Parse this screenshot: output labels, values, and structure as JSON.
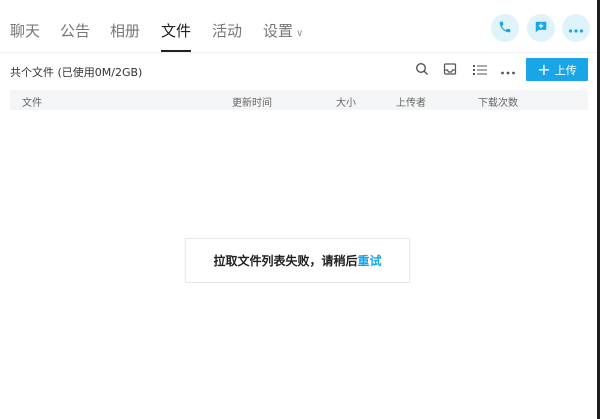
{
  "tabs": [
    {
      "label": "聊天"
    },
    {
      "label": "公告"
    },
    {
      "label": "相册"
    },
    {
      "label": "文件",
      "active": true
    },
    {
      "label": "活动"
    },
    {
      "label": "设置"
    }
  ],
  "header_icons": [
    "phone-icon",
    "chat-message-icon",
    "more-icon"
  ],
  "toolbar": {
    "title": "共个文件 (已使用0M/2GB)",
    "upload_label": "上传",
    "icons": [
      "search-icon",
      "inbox-icon",
      "list-view-icon",
      "more-icon"
    ]
  },
  "table": {
    "columns": [
      "文件",
      "更新时间",
      "大小",
      "上传者",
      "下载次数"
    ]
  },
  "error": {
    "message": "拉取文件列表失败，请稍后",
    "retry_label": "重试"
  },
  "colors": {
    "accent": "#1aa6e6",
    "icon_bg": "#dff3fb",
    "header_bg": "#f4f5f7"
  }
}
